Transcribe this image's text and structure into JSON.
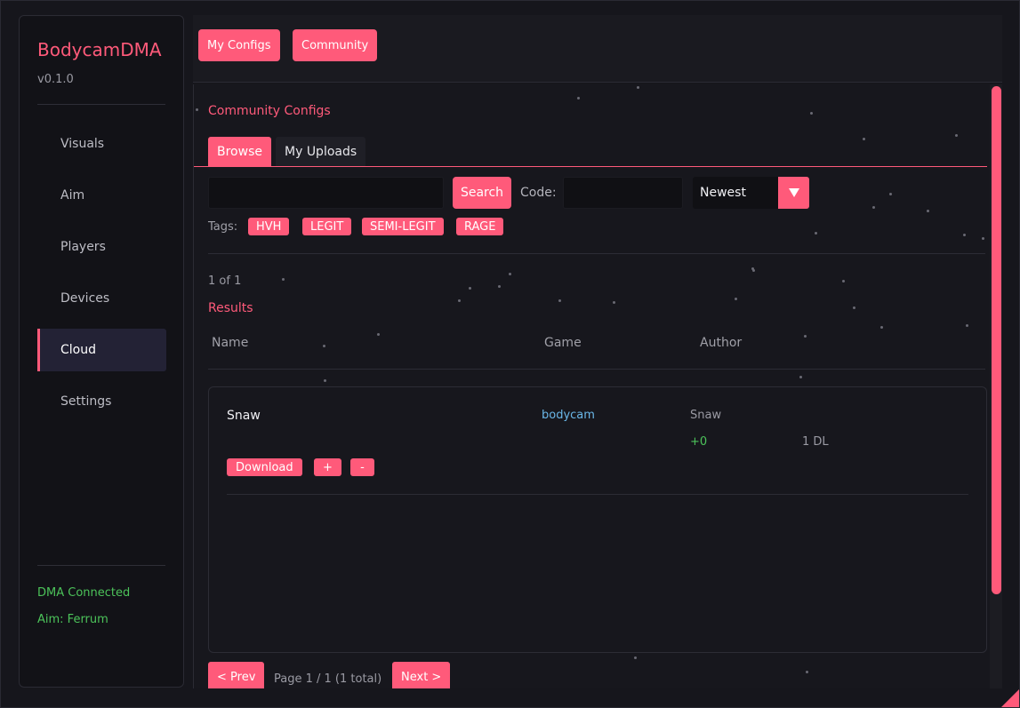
{
  "app": {
    "brand": "BodycamDMA",
    "version": "v0.1.0",
    "accent": "#ff5a7a"
  },
  "sidebar": {
    "items": [
      {
        "label": "Visuals"
      },
      {
        "label": "Aim"
      },
      {
        "label": "Players"
      },
      {
        "label": "Devices"
      },
      {
        "label": "Cloud",
        "active": true
      },
      {
        "label": "Settings"
      }
    ],
    "status_dma": "DMA Connected",
    "status_aim": "Aim: Ferrum"
  },
  "topbar": {
    "my_configs": "My Configs",
    "community": "Community"
  },
  "community": {
    "title": "Community Configs",
    "tabs": [
      "Browse",
      "My Uploads"
    ],
    "search_button": "Search",
    "search_value": "",
    "code_label": "Code:",
    "code_value": "",
    "sort_selected": "Newest",
    "tags_label": "Tags:",
    "tags": [
      "HVH",
      "LEGIT",
      "SEMI-LEGIT",
      "RAGE"
    ],
    "count_text": "1 of 1",
    "results_title": "Results",
    "columns": [
      "Name",
      "Game",
      "Author"
    ],
    "row": {
      "name": "Snaw",
      "game": "bodycam",
      "author": "Snaw",
      "votes": "+0",
      "downloads": "1 DL",
      "download_button": "Download",
      "plus_button": "+",
      "minus_button": "-"
    },
    "pager": {
      "prev": "< Prev",
      "info": "Page 1 / 1 (1 total)",
      "next": "Next >"
    }
  },
  "colors": {
    "game_link": "#6ab7e8",
    "votes": "#4cc35a",
    "status": "#4cc35a"
  }
}
